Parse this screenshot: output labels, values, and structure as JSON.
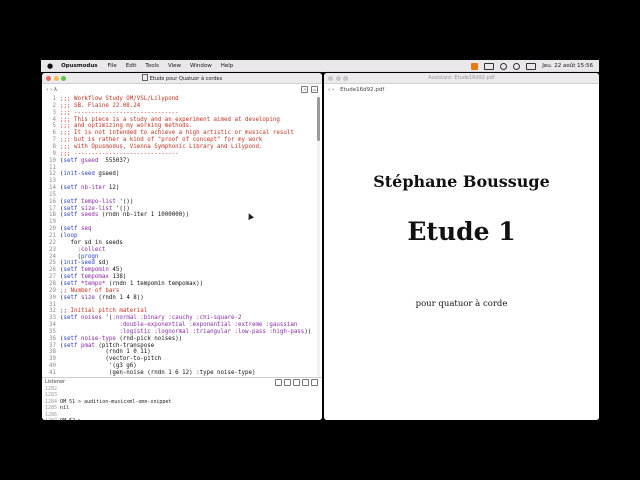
{
  "menubar": {
    "app_name": "Opusmodus",
    "menus": [
      "File",
      "Edit",
      "Tools",
      "View",
      "Window",
      "Help"
    ],
    "datetime": "Jeu. 22 août  15:56"
  },
  "left_window": {
    "title": "Etude pour Quatuor à cordes",
    "toolbar_left": "‹  ›   λ",
    "lines": [
      {
        "n": "1",
        "parts": [
          {
            "c": "cm",
            "t": ";;; Workflow Study OM/VSL/Lilypond"
          }
        ]
      },
      {
        "n": "2",
        "parts": [
          {
            "c": "cm",
            "t": ";;; SB. Flaine 22.08.24"
          }
        ]
      },
      {
        "n": "3",
        "parts": [
          {
            "c": "cm",
            "t": ";;; ------------------------------"
          }
        ]
      },
      {
        "n": "4",
        "parts": [
          {
            "c": "cm",
            "t": ";;; This piece is a study and an experiment aimed at developing"
          }
        ]
      },
      {
        "n": "5",
        "parts": [
          {
            "c": "cm",
            "t": ";;; and optimizing my working methods."
          }
        ]
      },
      {
        "n": "6",
        "parts": [
          {
            "c": "cm",
            "t": ";;; It is not intended to achieve a high artistic or musical result"
          }
        ]
      },
      {
        "n": "7",
        "parts": [
          {
            "c": "cm",
            "t": ";;; but is rather a kind of \"proof of concept\" for my work"
          }
        ]
      },
      {
        "n": "8",
        "parts": [
          {
            "c": "cm",
            "t": ";;; with Opusmodus, Vienna Symphonic Library and Lilypond."
          }
        ]
      },
      {
        "n": "9",
        "parts": [
          {
            "c": "cm",
            "t": ";;; ------------------------------"
          }
        ]
      },
      {
        "n": "10",
        "parts": [
          {
            "c": "tx",
            "t": "("
          },
          {
            "c": "fn",
            "t": "setf"
          },
          {
            "c": "ky",
            "t": " gseed"
          },
          {
            "c": "tx",
            "t": "  555037)"
          }
        ]
      },
      {
        "n": "11",
        "parts": []
      },
      {
        "n": "12",
        "parts": [
          {
            "c": "tx",
            "t": "("
          },
          {
            "c": "fn",
            "t": "init-seed"
          },
          {
            "c": "tx",
            "t": " gseed)"
          }
        ]
      },
      {
        "n": "13",
        "parts": []
      },
      {
        "n": "14",
        "parts": [
          {
            "c": "tx",
            "t": "("
          },
          {
            "c": "fn",
            "t": "setf"
          },
          {
            "c": "ky",
            "t": " nb-iter"
          },
          {
            "c": "tx",
            "t": " 12)"
          }
        ]
      },
      {
        "n": "15",
        "parts": []
      },
      {
        "n": "16",
        "parts": [
          {
            "c": "tx",
            "t": "("
          },
          {
            "c": "fn",
            "t": "setf"
          },
          {
            "c": "ky",
            "t": " tempo-list"
          },
          {
            "c": "tx",
            "t": " '())"
          }
        ]
      },
      {
        "n": "17",
        "parts": [
          {
            "c": "tx",
            "t": "("
          },
          {
            "c": "fn",
            "t": "setf"
          },
          {
            "c": "ky",
            "t": " size-list"
          },
          {
            "c": "tx",
            "t": " '())"
          }
        ]
      },
      {
        "n": "18",
        "parts": [
          {
            "c": "tx",
            "t": "("
          },
          {
            "c": "fn",
            "t": "setf"
          },
          {
            "c": "ky",
            "t": " seeds"
          },
          {
            "c": "tx",
            "t": " (rndn nb-iter 1 1000000))"
          }
        ]
      },
      {
        "n": "19",
        "parts": []
      },
      {
        "n": "20",
        "parts": [
          {
            "c": "tx",
            "t": "("
          },
          {
            "c": "fn",
            "t": "setf"
          },
          {
            "c": "ky",
            "t": " seq"
          }
        ]
      },
      {
        "n": "21",
        "parts": [
          {
            "c": "tx",
            "t": "("
          },
          {
            "c": "fn",
            "t": "loop"
          }
        ]
      },
      {
        "n": "22",
        "parts": [
          {
            "c": "tx",
            "t": "   for sd in seeds"
          }
        ]
      },
      {
        "n": "23",
        "parts": [
          {
            "c": "ky",
            "t": "     :collect"
          }
        ]
      },
      {
        "n": "24",
        "parts": [
          {
            "c": "tx",
            "t": "     ("
          },
          {
            "c": "fn",
            "t": "progn"
          }
        ]
      },
      {
        "n": "25",
        "parts": [
          {
            "c": "tx",
            "t": "("
          },
          {
            "c": "fn",
            "t": "init-seed"
          },
          {
            "c": "tx",
            "t": " sd)"
          }
        ]
      },
      {
        "n": "26",
        "parts": [
          {
            "c": "tx",
            "t": "("
          },
          {
            "c": "fn",
            "t": "setf"
          },
          {
            "c": "ky",
            "t": " tempomin"
          },
          {
            "c": "tx",
            "t": " 45)"
          }
        ]
      },
      {
        "n": "27",
        "parts": [
          {
            "c": "tx",
            "t": "("
          },
          {
            "c": "fn",
            "t": "setf"
          },
          {
            "c": "ky",
            "t": " tempomax"
          },
          {
            "c": "tx",
            "t": " 138)"
          }
        ]
      },
      {
        "n": "28",
        "parts": [
          {
            "c": "tx",
            "t": "("
          },
          {
            "c": "fn",
            "t": "setf"
          },
          {
            "c": "ky",
            "t": " *tempo*"
          },
          {
            "c": "tx",
            "t": " (rndn 1 tempomin tempomax))"
          }
        ]
      },
      {
        "n": "29",
        "parts": [
          {
            "c": "cm",
            "t": ";; Number of bars"
          }
        ]
      },
      {
        "n": "30",
        "parts": [
          {
            "c": "tx",
            "t": "("
          },
          {
            "c": "fn",
            "t": "setf"
          },
          {
            "c": "ky",
            "t": " size"
          },
          {
            "c": "tx",
            "t": " (rndn 1 4 8))"
          }
        ]
      },
      {
        "n": "31",
        "parts": []
      },
      {
        "n": "32",
        "parts": [
          {
            "c": "cm",
            "t": ";; Initial pitch material"
          }
        ]
      },
      {
        "n": "33",
        "parts": [
          {
            "c": "tx",
            "t": "("
          },
          {
            "c": "fn",
            "t": "setf"
          },
          {
            "c": "ky",
            "t": " noises"
          },
          {
            "c": "tx",
            "t": " '("
          },
          {
            "c": "ky",
            "t": ":normal :binary :cauchy :chi-square-2"
          }
        ]
      },
      {
        "n": "34",
        "parts": [
          {
            "c": "ky",
            "t": "                 :double-exponential :exponential :extreme :gaussian"
          }
        ]
      },
      {
        "n": "35",
        "parts": [
          {
            "c": "ky",
            "t": "                 :logistic :lognormal :triangular :low-pass :high-pass"
          },
          {
            "c": "tx",
            "t": "))"
          }
        ]
      },
      {
        "n": "36",
        "parts": [
          {
            "c": "tx",
            "t": "("
          },
          {
            "c": "fn",
            "t": "setf"
          },
          {
            "c": "ky",
            "t": " noise-type"
          },
          {
            "c": "tx",
            "t": " (rnd-pick noises))"
          }
        ]
      },
      {
        "n": "37",
        "parts": [
          {
            "c": "tx",
            "t": "("
          },
          {
            "c": "fn",
            "t": "setf"
          },
          {
            "c": "ky",
            "t": " pmat"
          },
          {
            "c": "tx",
            "t": " (pitch-transpose"
          }
        ]
      },
      {
        "n": "38",
        "parts": [
          {
            "c": "tx",
            "t": "             (rndn 1 0 11)"
          }
        ]
      },
      {
        "n": "39",
        "parts": [
          {
            "c": "tx",
            "t": "             (vector-to-pitch"
          }
        ]
      },
      {
        "n": "40",
        "parts": [
          {
            "c": "tx",
            "t": "              '(g3 g6)"
          }
        ]
      },
      {
        "n": "41",
        "parts": [
          {
            "c": "tx",
            "t": "              (gen-noise (rndn 1 6 12) :type noise-type)"
          }
        ]
      }
    ],
    "listener": {
      "label": "Listener",
      "lines": [
        {
          "a": "1282",
          "b": ""
        },
        {
          "a": "1283",
          "b": ""
        },
        {
          "a": "1284",
          "b": " OM 51 > audition-musicxml-omn-snippet"
        },
        {
          "a": "1285",
          "b": " nil"
        },
        {
          "a": "1286",
          "b": ""
        },
        {
          "a": "1287",
          "b": " OM 52 >"
        }
      ]
    }
  },
  "right_window": {
    "title": "Assistant: Etude16d92.pdf",
    "tab": "Etude16d92.pdf",
    "pdf": {
      "author": "Stéphane Boussuge",
      "title": "Etude 1",
      "subtitle": "pour quatuor à corde"
    }
  },
  "colors": {
    "comment": "#c0321f",
    "keyword": "#8a29a8",
    "function": "#2a44c8"
  }
}
